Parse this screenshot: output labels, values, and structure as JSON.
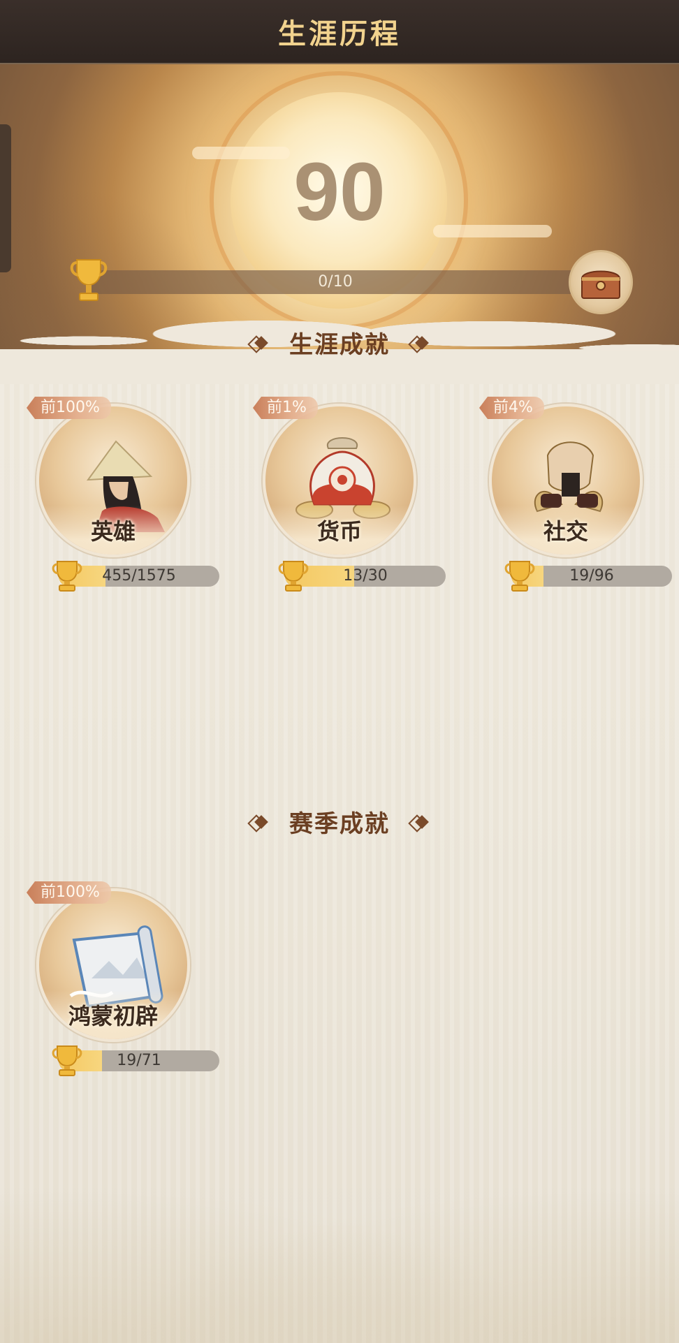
{
  "header": {
    "title": "生涯历程"
  },
  "banner": {
    "score": "90",
    "progress_text": "0/10",
    "progress_fraction": 0.0
  },
  "sections": [
    {
      "title": "生涯成就"
    },
    {
      "title": "赛季成就"
    }
  ],
  "career_cards": [
    {
      "badge": "前100%",
      "name": "英雄",
      "progress": "455/1575",
      "fill_fraction": 0.29,
      "icon": "straw-hat-hero-icon"
    },
    {
      "badge": "前1%",
      "name": "货币",
      "progress": "13/30",
      "fill_fraction": 0.43,
      "icon": "money-bag-icon"
    },
    {
      "badge": "前4%",
      "name": "社交",
      "progress": "19/96",
      "fill_fraction": 0.2,
      "icon": "handshake-icon"
    }
  ],
  "season_cards": [
    {
      "badge": "前100%",
      "name": "鸿蒙初辟",
      "progress": "19/71",
      "fill_fraction": 0.27,
      "icon": "scroll-icon"
    }
  ],
  "colors": {
    "header_bg": "#2d2420",
    "title_gold": "#f2d38e",
    "section_brown": "#6b3f22",
    "bar_fill": "#f4c861",
    "badge": "#c97f5a"
  }
}
